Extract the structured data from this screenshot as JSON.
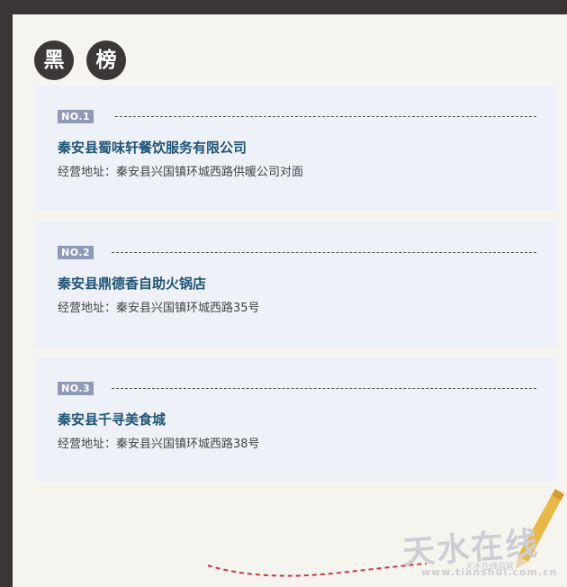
{
  "section": {
    "title_chars": [
      "黑",
      "榜"
    ]
  },
  "entries": [
    {
      "rank": "NO.1",
      "name": "秦安县蜀味轩餐饮服务有限公司",
      "address": "经营地址：秦安县兴国镇环城西路供暖公司对面"
    },
    {
      "rank": "NO.2",
      "name": "秦安县鼎德香自助火锅店",
      "address": "经营地址：秦安县兴国镇环城西路35号"
    },
    {
      "rank": "NO.3",
      "name": "秦安县千寻美食城",
      "address": "经营地址：秦安县兴国镇环城西路38号"
    }
  ],
  "watermark": {
    "brand": "天水在线",
    "url": "www.tianshui.com.cn",
    "small": "天水在线监管"
  },
  "colors": {
    "background_frame": "#3a3635",
    "paper": "#f6f4ef",
    "card": "#eef1f8",
    "badge": "#8e9ab8",
    "name": "#1f5575",
    "pencil": "#e8b94a"
  }
}
